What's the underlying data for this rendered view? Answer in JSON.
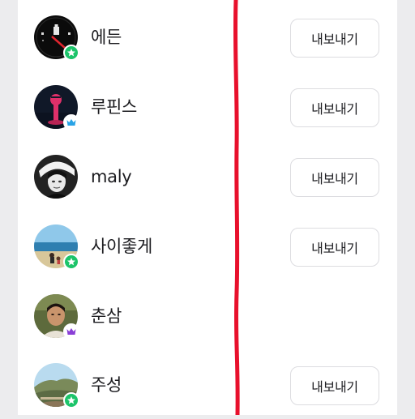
{
  "members": [
    {
      "name": "에든",
      "badge": "star-icon",
      "badge_color": "#1cc46a",
      "button": "내보내기",
      "has_button": true
    },
    {
      "name": "루핀스",
      "badge": "crown-icon",
      "badge_color": "#29a3e6",
      "button": "내보내기",
      "has_button": true
    },
    {
      "name": "maly",
      "badge": "",
      "badge_color": "",
      "button": "내보내기",
      "has_button": true
    },
    {
      "name": "사이좋게",
      "badge": "star-icon",
      "badge_color": "#1cc46a",
      "button": "내보내기",
      "has_button": true
    },
    {
      "name": "춘삼",
      "badge": "crown-icon",
      "badge_color": "#8a3fd6",
      "button": "",
      "has_button": false
    },
    {
      "name": "주성",
      "badge": "star-icon",
      "badge_color": "#1cc46a",
      "button": "내보내기",
      "has_button": true
    }
  ],
  "annotation_color": "#e8102c"
}
